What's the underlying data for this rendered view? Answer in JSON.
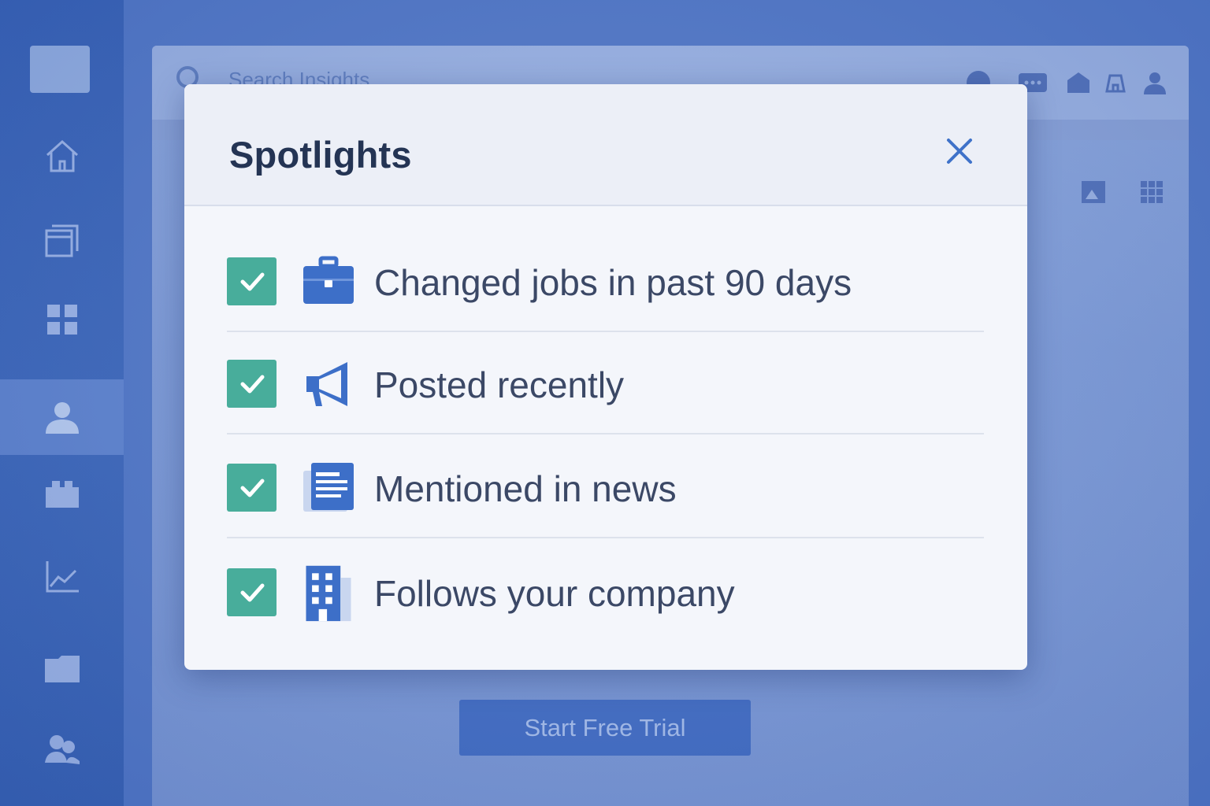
{
  "search": {
    "placeholder": "Search Insights"
  },
  "sidebar": {
    "items": [
      {
        "name": "home",
        "icon": "home-icon"
      },
      {
        "name": "pages",
        "icon": "pages-icon"
      },
      {
        "name": "apps",
        "icon": "grid-apps-icon"
      },
      {
        "name": "people",
        "icon": "person-icon",
        "active": true
      },
      {
        "name": "accounts",
        "icon": "briefcase-icon"
      },
      {
        "name": "analytics",
        "icon": "chart-icon"
      },
      {
        "name": "folders",
        "icon": "folder-icon"
      },
      {
        "name": "teams",
        "icon": "team-icon"
      }
    ]
  },
  "topbar": {
    "icons": [
      "help-icon",
      "chat-icon",
      "gift-icon",
      "bell-icon",
      "user-icon"
    ]
  },
  "modal": {
    "title": "Spotlights",
    "options": [
      {
        "label": "Changed jobs in past 90 days",
        "checked": true,
        "icon": "briefcase-icon"
      },
      {
        "label": "Posted recently",
        "checked": true,
        "icon": "megaphone-icon"
      },
      {
        "label": "Mentioned in news",
        "checked": true,
        "icon": "newspaper-icon"
      },
      {
        "label": "Follows your company",
        "checked": true,
        "icon": "building-icon"
      }
    ]
  },
  "cta": {
    "label": "Start Free Trial"
  },
  "colors": {
    "accent": "#3e6ac2",
    "checkbox": "#48ad9b",
    "title": "#243454",
    "text": "#3b4866",
    "icon": "#3d6fc8"
  }
}
